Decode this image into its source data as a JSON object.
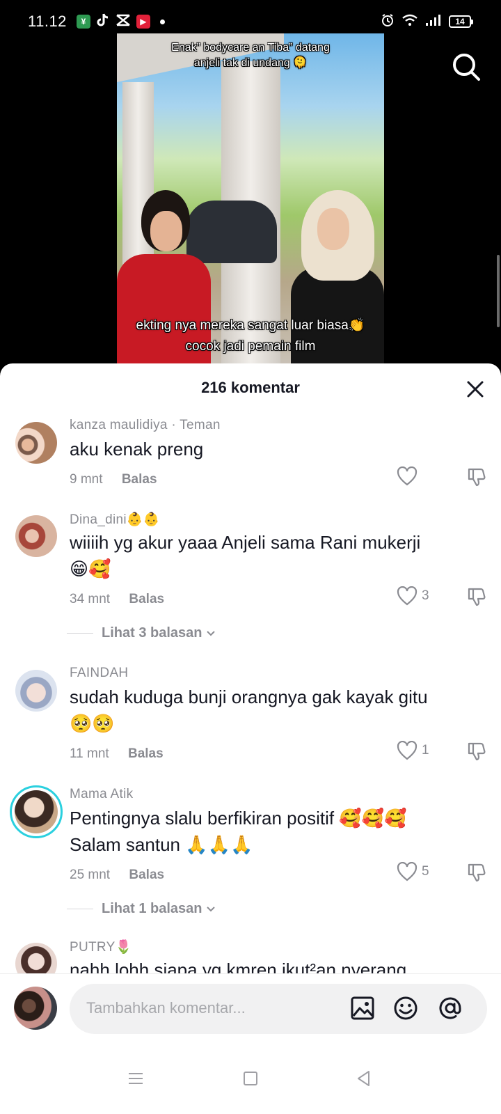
{
  "status_bar": {
    "time": "11.12",
    "battery": "14",
    "app_badges": [
      "money-app",
      "tiktok",
      "capcut",
      "video-app"
    ]
  },
  "video": {
    "caption_top": "Enak” bodycare an Tiba” datang anjeli tak di undang 🫠",
    "caption_bottom_line1": "ekting nya mereka sangat luar biasa👏",
    "caption_bottom_line2": "cocok jadi pemain film"
  },
  "comments_sheet": {
    "title": "216 komentar",
    "comments": [
      {
        "username": "kanza maulidiya · Teman",
        "text": "aku kenak preng",
        "time": "9 mnt",
        "reply_label": "Balas",
        "likes": ""
      },
      {
        "username": "Dina_dini👶👶",
        "text": "wiiiih yg akur yaaa Anjeli sama Rani mukerji",
        "emojis": "😁🥰",
        "time": "34 mnt",
        "reply_label": "Balas",
        "likes": "3",
        "view_replies": "Lihat 3 balasan"
      },
      {
        "username": "FAINDAH",
        "text": "sudah kuduga bunji orangnya gak kayak gitu",
        "emojis": "🥺🥺",
        "time": "11 mnt",
        "reply_label": "Balas",
        "likes": "1"
      },
      {
        "username": "Mama Atik",
        "text": "Pentingnya slalu berfikiran positif 🥰🥰🥰",
        "text2": "Salam santun 🙏🙏🙏",
        "time": "25 mnt",
        "reply_label": "Balas",
        "likes": "5",
        "view_replies": "Lihat 1 balasan"
      },
      {
        "username": "PUTRY🌷",
        "text": "nahh lohh siapa yg kmren ikut²an nyerang"
      }
    ]
  },
  "input_bar": {
    "placeholder": "Tambahkan komentar..."
  },
  "colors": {
    "accent_ring": "#2bd0df",
    "muted_text": "#8a8b91",
    "primary_text": "#161823"
  }
}
